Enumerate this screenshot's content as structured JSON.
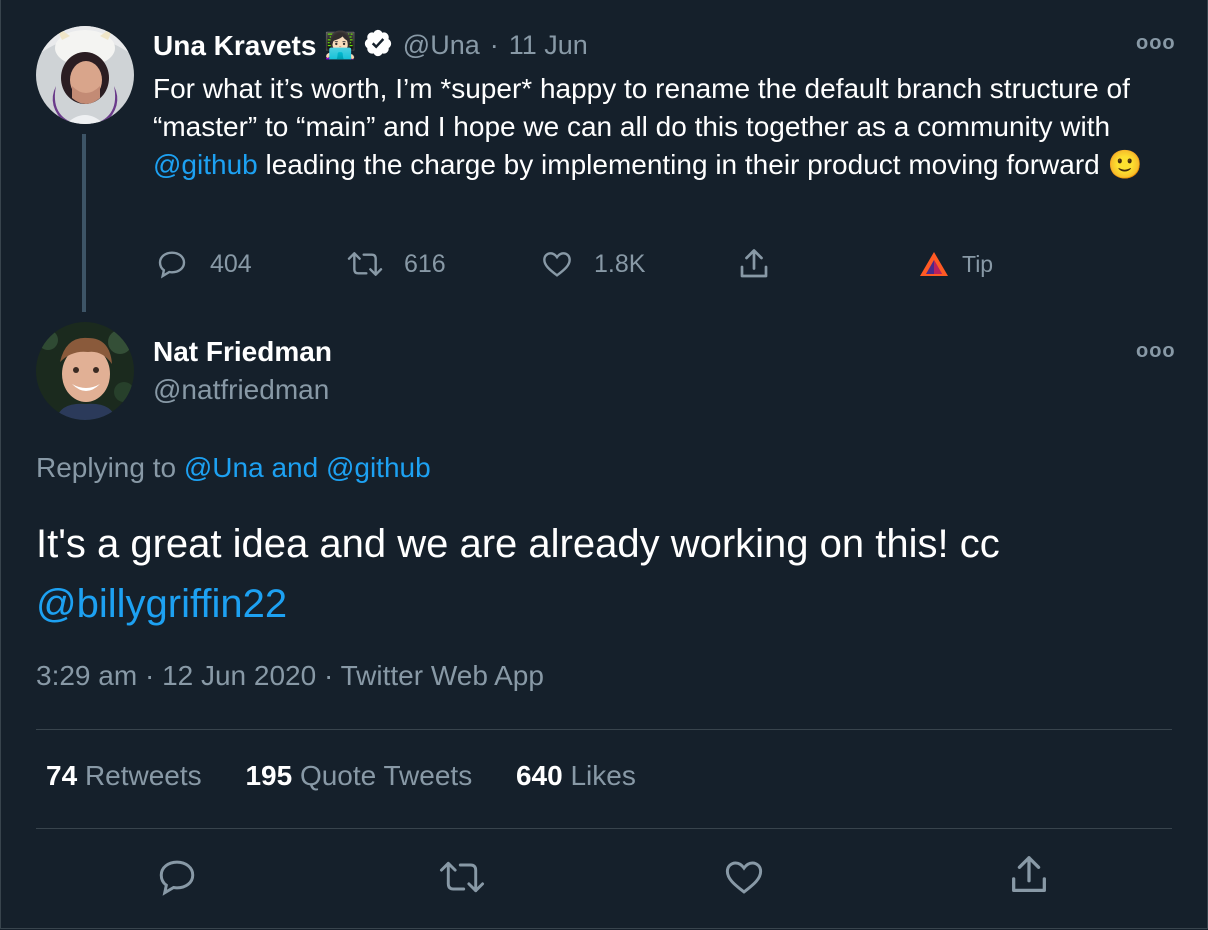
{
  "original_tweet": {
    "author_name": "Una Kravets",
    "author_emoji": "👩🏻‍💻",
    "verified_icon": "verified-badge-icon",
    "handle": "@Una",
    "separator": "·",
    "date": "11 Jun",
    "text_before": "For what it’s worth, I’m *super* happy to rename the default branch structure of “master” to “main” and I hope we can all do this together as a community with ",
    "mention": "@github",
    "text_after": " leading the charge by implementing in their product moving forward ",
    "emoji": "🙂",
    "more_label": "ooo",
    "actions": {
      "reply_count": "404",
      "retweet_count": "616",
      "like_count": "1.8K",
      "tip_label": "Tip"
    }
  },
  "reply_tweet": {
    "author_name": "Nat Friedman",
    "handle": "@natfriedman",
    "more_label": "ooo",
    "replying_prefix": "Replying to ",
    "replying_user1": "@Una",
    "replying_and": " and ",
    "replying_user2": "@github",
    "text": "It's a great idea and we are already working on this! cc ",
    "text_mention": "@billygriffin22",
    "time": "3:29 am",
    "date": "12 Jun 2020",
    "source": "Twitter Web App",
    "separator": " · ",
    "stats": {
      "retweets_count": "74",
      "retweets_label": "Retweets",
      "quotes_count": "195",
      "quotes_label": "Quote Tweets",
      "likes_count": "640",
      "likes_label": "Likes"
    }
  },
  "colors": {
    "background": "#15202b",
    "link": "#1da1f2",
    "muted": "#8899a6",
    "divider": "#38444d"
  }
}
